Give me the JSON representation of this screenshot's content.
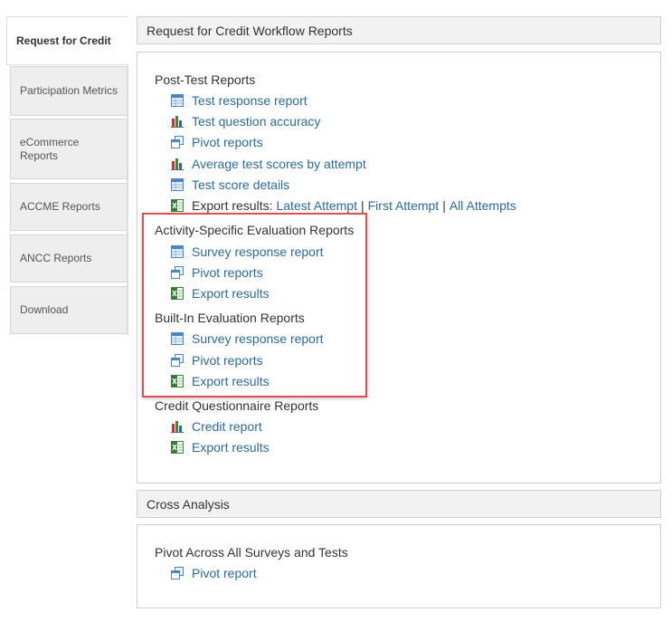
{
  "tabs": [
    {
      "label": "Request for Credit"
    },
    {
      "label": "Participation Metrics"
    },
    {
      "label": "eCommerce Reports"
    },
    {
      "label": "ACCME Reports"
    },
    {
      "label": "ANCC Reports"
    },
    {
      "label": "Download"
    }
  ],
  "workflow_panel": {
    "title": "Request for Credit Workflow Reports",
    "sections": [
      {
        "title": "Post-Test Reports",
        "items": [
          {
            "icon": "table-icon",
            "label": "Test response report"
          },
          {
            "icon": "bar-chart-icon",
            "label": "Test question accuracy"
          },
          {
            "icon": "pivot-icon",
            "label": "Pivot reports"
          },
          {
            "icon": "bar-chart-icon",
            "label": "Average test scores by attempt"
          },
          {
            "icon": "table-icon",
            "label": "Test score details"
          }
        ],
        "export": {
          "icon": "excel-icon",
          "prefix": "Export results:",
          "links": [
            "Latest Attempt",
            "First Attempt",
            "All Attempts"
          ],
          "separator": "|"
        }
      },
      {
        "title": "Activity-Specific Evaluation Reports",
        "items": [
          {
            "icon": "table-icon",
            "label": "Survey response report"
          },
          {
            "icon": "pivot-icon",
            "label": "Pivot reports"
          },
          {
            "icon": "excel-icon",
            "label": "Export results"
          }
        ]
      },
      {
        "title": "Built-In Evaluation Reports",
        "items": [
          {
            "icon": "table-icon",
            "label": "Survey response report"
          },
          {
            "icon": "pivot-icon",
            "label": "Pivot reports"
          },
          {
            "icon": "excel-icon",
            "label": "Export results"
          }
        ]
      },
      {
        "title": "Credit Questionnaire Reports",
        "items": [
          {
            "icon": "bar-chart-icon",
            "label": "Credit report"
          },
          {
            "icon": "excel-icon",
            "label": "Export results"
          }
        ]
      }
    ]
  },
  "cross_panel": {
    "title": "Cross Analysis",
    "sections": [
      {
        "title": "Pivot Across All Surveys and Tests",
        "items": [
          {
            "icon": "pivot-icon",
            "label": "Pivot report"
          }
        ]
      }
    ]
  },
  "colors": {
    "link": "#2a6b9c",
    "highlight_border": "#e05050",
    "tab_bg": "#eeeeee"
  }
}
